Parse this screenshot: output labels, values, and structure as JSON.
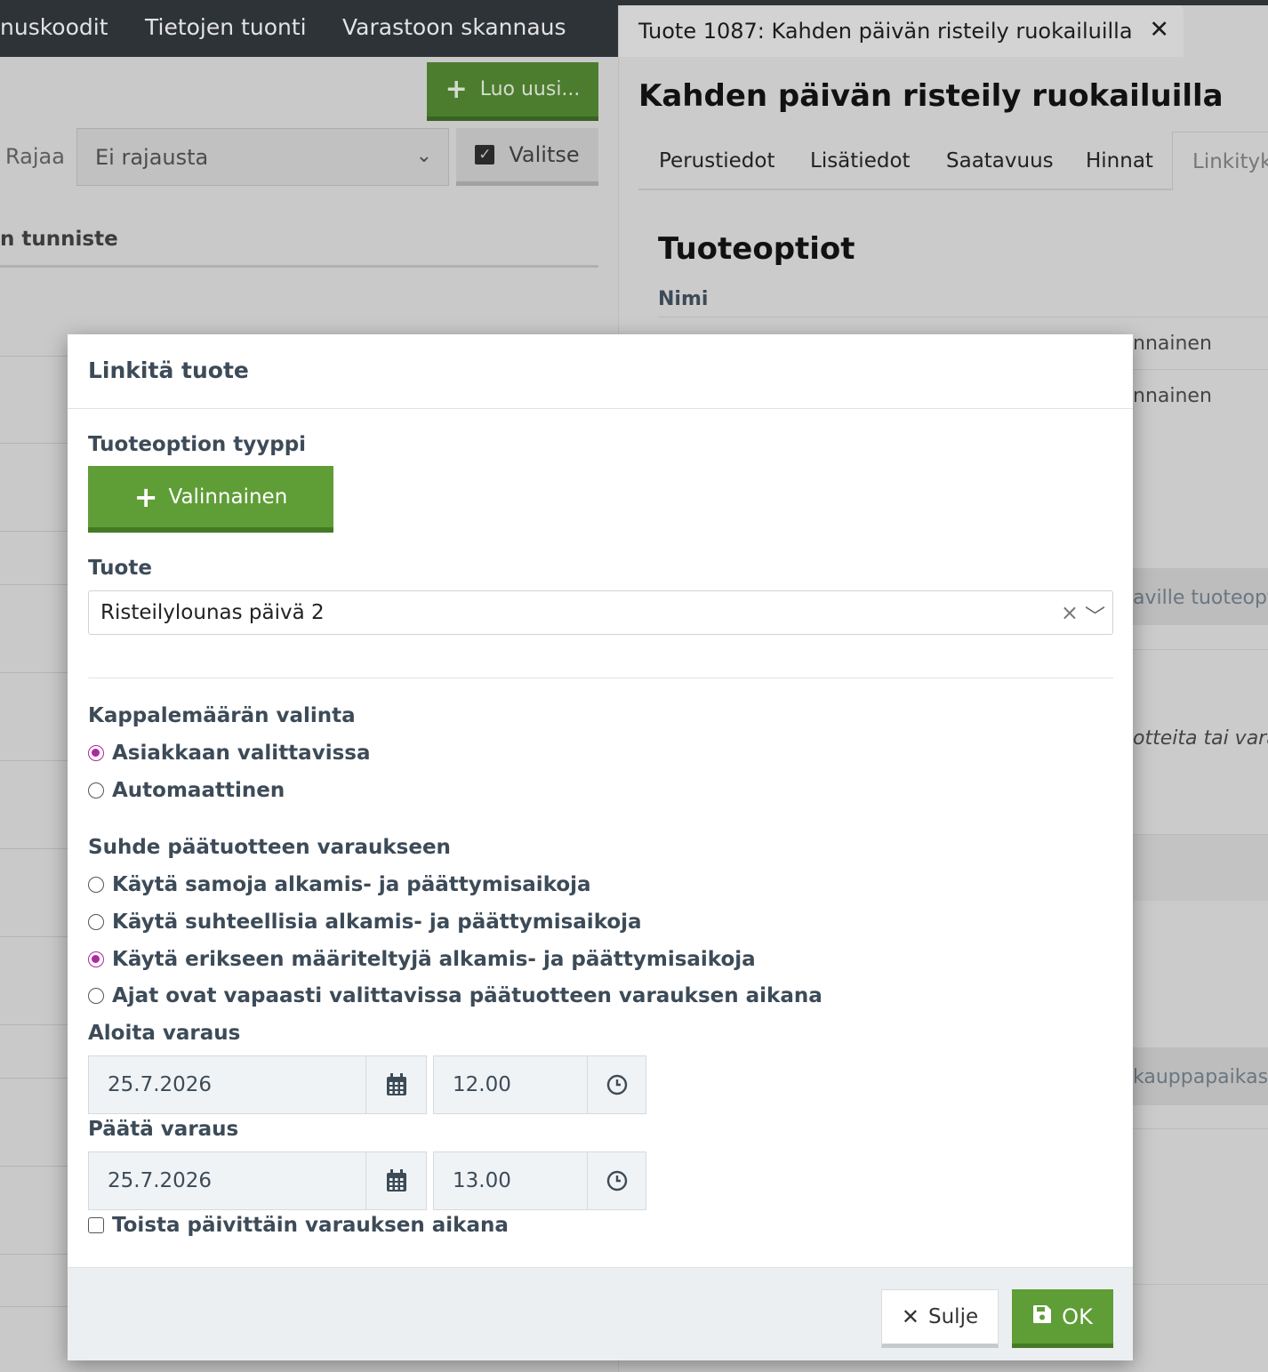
{
  "topnav": {
    "items": [
      "nuskoodit",
      "Tietojen tuonti",
      "Varastoon skannaus"
    ]
  },
  "list_panel": {
    "new_button_label": "Luo uusi...",
    "filter_label": "Rajaa",
    "filter_value": "Ei rajausta",
    "select_button_label": "Valitse",
    "column_header": "n tunniste"
  },
  "detail_panel": {
    "tab_title": "Tuote 1087: Kahden päivän risteily ruokailuilla",
    "product_title": "Kahden päivän risteily ruokailuilla",
    "tabs": [
      "Perustiedot",
      "Lisätiedot",
      "Saatavuus",
      "Hinnat",
      "Linkityks"
    ],
    "section_title": "Tuoteoptiot",
    "column_name": "Nimi",
    "fragments": {
      "row1": "nnainen",
      "row2": "nnainen",
      "band1": "aville tuoteopti",
      "italic": "otteita tai vara",
      "band2": "kauppapaikass"
    }
  },
  "modal": {
    "title": "Linkitä tuote",
    "option_type_label": "Tuoteoption tyyppi",
    "option_type_button": "Valinnainen",
    "product_label": "Tuote",
    "product_value": "Risteilylounas päivä 2",
    "quantity_label": "Kappalemäärän valinta",
    "quantity_options": [
      {
        "label": "Asiakkaan valittavissa",
        "checked": true
      },
      {
        "label": "Automaattinen",
        "checked": false
      }
    ],
    "relation_label": "Suhde päätuotteen varaukseen",
    "relation_options": [
      {
        "label": "Käytä samoja alkamis- ja päättymisaikoja",
        "checked": false
      },
      {
        "label": "Käytä suhteellisia alkamis- ja päättymisaikoja",
        "checked": false
      },
      {
        "label": "Käytä erikseen määriteltyjä alkamis- ja päättymisaikoja",
        "checked": true
      },
      {
        "label": "Ajat ovat vapaasti valittavissa päätuotteen varauksen aikana",
        "checked": false
      }
    ],
    "start_label": "Aloita varaus",
    "start_date": "25.7.2026",
    "start_time": "12.00",
    "end_label": "Päätä varaus",
    "end_date": "25.7.2026",
    "end_time": "13.00",
    "repeat_label": "Toista päivittäin varauksen aikana",
    "repeat_checked": false,
    "close_button": "Sulje",
    "ok_button": "OK"
  },
  "colors": {
    "primary_green": "#5f9d37",
    "radio_accent": "#b0279f",
    "topnav_bg": "#2e3338",
    "label_text": "#3d4b58"
  }
}
